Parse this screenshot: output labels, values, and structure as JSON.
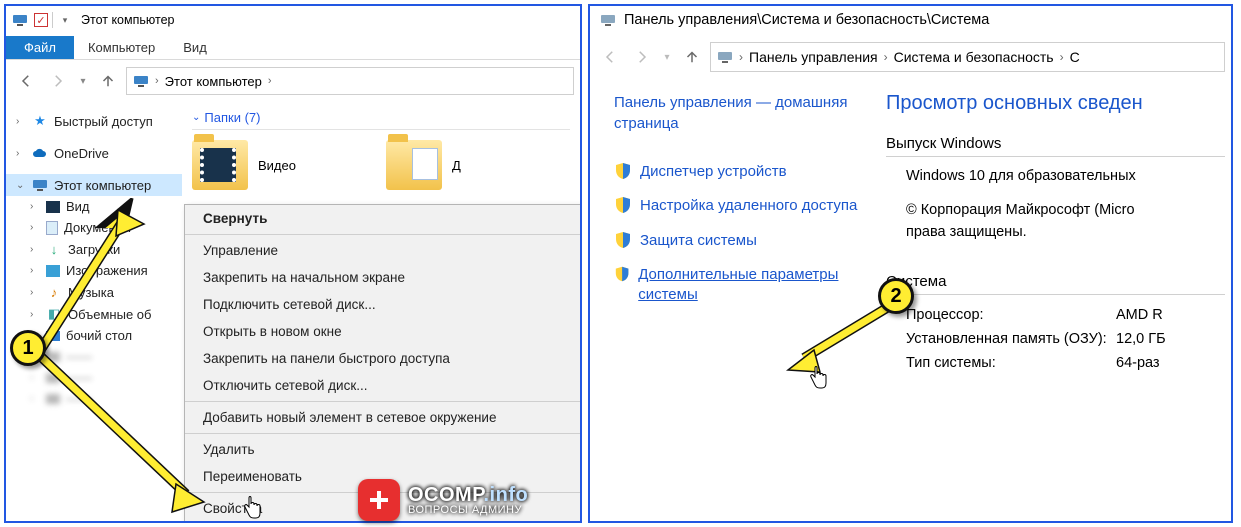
{
  "left": {
    "title": "Этот компьютер",
    "tabs": {
      "file": "Файл",
      "computer": "Компьютер",
      "view": "Вид"
    },
    "address": "Этот компьютер",
    "tree": {
      "quick": "Быстрый доступ",
      "onedrive": "OneDrive",
      "thispc": "Этот компьютер",
      "sub": {
        "video": "Вид",
        "documents": "Документы",
        "downloads": "Загрузки",
        "pictures": "Изображения",
        "music": "Музыка",
        "volumes": "Объемные об",
        "desktop": "бочий стол"
      }
    },
    "group": "Папки (7)",
    "folders": {
      "video": "Видео",
      "documents_short": "Д"
    },
    "ctx": {
      "collapse": "Свернуть",
      "manage": "Управление",
      "pin_start": "Закрепить на начальном экране",
      "map_drive": "Подключить сетевой диск...",
      "open_new": "Открыть в новом окне",
      "pin_quick": "Закрепить на панели быстрого доступа",
      "disconnect": "Отключить сетевой диск...",
      "add_network": "Добавить новый элемент в сетевое окружение",
      "delete": "Удалить",
      "rename": "Переименовать",
      "properties": "Свойства"
    }
  },
  "right": {
    "title_path": "Панель управления\\Система и безопасность\\Система",
    "crumbs": {
      "cp": "Панель управления",
      "sec": "Система и безопасность",
      "sys": "С"
    },
    "side": {
      "home": "Панель управления — домашняя страница",
      "devmgr": "Диспетчер устройств",
      "remote": "Настройка удаленного доступа",
      "protect": "Защита системы",
      "advanced": "Дополнительные параметры системы"
    },
    "main": {
      "heading": "Просмотр основных сведен",
      "edition_h": "Выпуск Windows",
      "edition_v": "Windows 10 для образовательных",
      "copyright": "© Корпорация Майкрософт (Micro",
      "rights": "права защищены.",
      "system_h": "Система",
      "cpu_k": "Процессор:",
      "cpu_v": "AMD R",
      "ram_k": "Установленная память (ОЗУ):",
      "ram_v": "12,0 ГБ",
      "type_k": "Тип системы:",
      "type_v": "64-раз"
    }
  },
  "callouts": {
    "one": "1",
    "two": "2"
  },
  "watermark": {
    "brand": "OCOMP",
    "dot": ".",
    "tld": "info",
    "sub": "ВОПРОСЫ АДМИНУ"
  }
}
